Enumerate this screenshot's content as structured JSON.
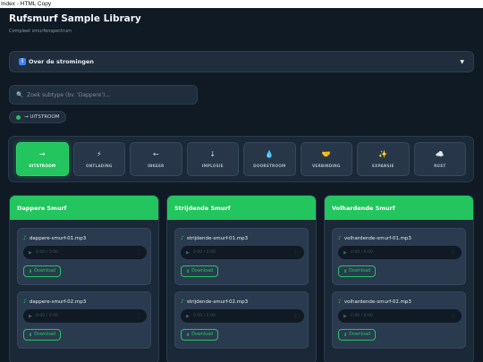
{
  "window": {
    "title": "Index - HTML Copy"
  },
  "header": {
    "title": "Rufsmurf Sample Library",
    "subtitle": "Compleet smurfenspectrum"
  },
  "accordion": {
    "icon": "info-icon",
    "label": "Over de stromingen"
  },
  "search": {
    "placeholder": "Zoek subtype (bv. 'Dappere')..."
  },
  "flow": {
    "label": "→ UITSTROOM",
    "dot_color": "#22c55e"
  },
  "tabs": [
    {
      "glyph": "→",
      "icon": "arrow-right-icon",
      "label": "UITSTROOM",
      "active": true
    },
    {
      "glyph": "⚡",
      "icon": "lightning-icon",
      "label": "ONTLADING"
    },
    {
      "glyph": "←",
      "icon": "arrow-left-icon",
      "label": "INKEER"
    },
    {
      "glyph": "↓",
      "icon": "arrow-down-icon",
      "label": "IMPLOSIE"
    },
    {
      "glyph": "💧",
      "icon": "droplet-icon",
      "label": "DOORSTROOM"
    },
    {
      "glyph": "🤝",
      "icon": "handshake-icon",
      "label": "VERBINDING"
    },
    {
      "glyph": "✨",
      "icon": "sparkles-icon",
      "label": "EXPANSIE"
    },
    {
      "glyph": "☁️",
      "icon": "cloud-icon",
      "label": "RUST"
    }
  ],
  "columns": [
    {
      "title": "Dappere Smurf",
      "files": [
        {
          "name": "dappere-smurf-01.mp3",
          "time": "0:00 / 0:00",
          "download": "Download"
        },
        {
          "name": "dappere-smurf-02.mp3",
          "time": "0:00 / 0:00",
          "download": "Download"
        }
      ]
    },
    {
      "title": "Strijdende Smurf",
      "files": [
        {
          "name": "strijdende-smurf-01.mp3",
          "time": "0:00 / 0:00",
          "download": "Download"
        },
        {
          "name": "strijdende-smurf-02.mp3",
          "time": "0:00 / 0:00",
          "download": "Download"
        }
      ]
    },
    {
      "title": "Volhardende Smurf",
      "files": [
        {
          "name": "volhardende-smurf-01.mp3",
          "time": "0:00 / 0:00",
          "download": "Download"
        },
        {
          "name": "volhardende-smurf-02.mp3",
          "time": "0:00 / 0:00",
          "download": "Download"
        }
      ]
    }
  ],
  "colors": {
    "accent": "#22c55e",
    "background": "#0f1a24",
    "panel": "#1b2837"
  }
}
